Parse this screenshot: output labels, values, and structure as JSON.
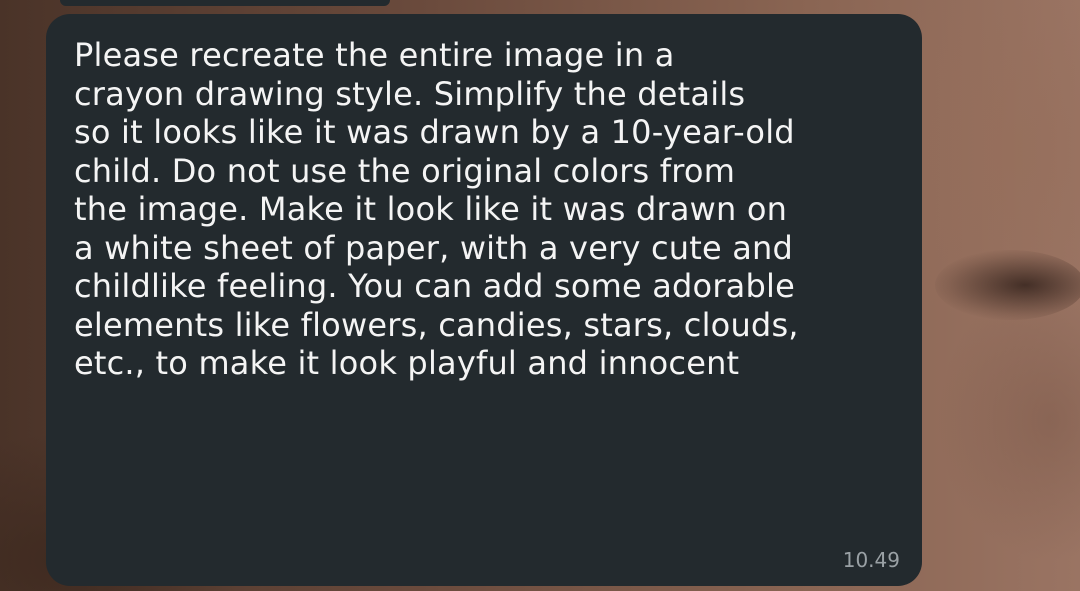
{
  "message": {
    "text": "Please recreate the entire image in a\ncrayon drawing style. Simplify the details\nso it looks like it was drawn by a 10-year-old\nchild. Do not use the original colors from\nthe image. Make it look like it was drawn on\na white sheet of paper, with a very cute and\nchildlike feeling. You can add some adorable\nelements like flowers, candies, stars, clouds,\netc., to make it look playful and innocent",
    "time": "10.49"
  },
  "colors": {
    "bubble_background": "#232a2e",
    "message_text": "#f4f4f4",
    "timestamp_text": "#9aa1a5"
  }
}
